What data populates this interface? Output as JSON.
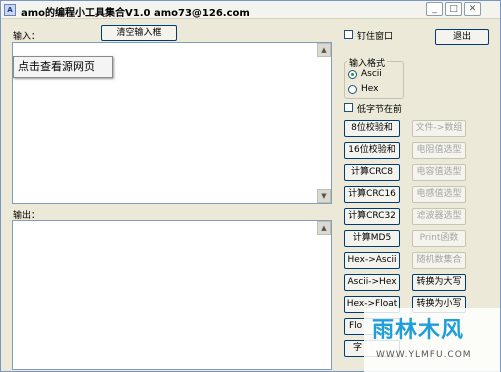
{
  "window": {
    "title": "amo的编程小工具集合V1.0   amo73@126.com",
    "icon_text": "A",
    "min_icon": "minimize-icon",
    "max_icon": "maximize-icon",
    "close_icon": "close-icon"
  },
  "input": {
    "label": "输入：",
    "clear_button": "清空输入框",
    "value": "",
    "tooltip": "点击查看源网页"
  },
  "output": {
    "label": "输出：",
    "value": ""
  },
  "options": {
    "pin_window": "钉住窗口",
    "exit_button": "退出",
    "format_group": "输入格式",
    "format_options": [
      "Ascii",
      "Hex"
    ],
    "format_selected": "Ascii",
    "low_byte_first": "低字节在前"
  },
  "buttons_left": [
    "8位校验和",
    "16位校验和",
    "计算CRC8",
    "计算CRC16",
    "计算CRC32",
    "计算MD5",
    "Hex->Ascii",
    "Ascii->Hex",
    "Hex->Float",
    "Flo",
    "字"
  ],
  "buttons_right": [
    "文件->数组",
    "电阻值选型",
    "电容值选型",
    "电感值选型",
    "滤波器选型",
    "Print函数",
    "随机数集合",
    "转换为大写",
    "转换为小写"
  ],
  "watermark": {
    "logo": "雨林木风",
    "url": "WWW.YLMFU.COM"
  },
  "colors": {
    "window_bg": "#ece9d8",
    "button_border": "#003c74",
    "disabled_text": "#a6a6a0",
    "watermark_brand": "#1f9fd9"
  }
}
